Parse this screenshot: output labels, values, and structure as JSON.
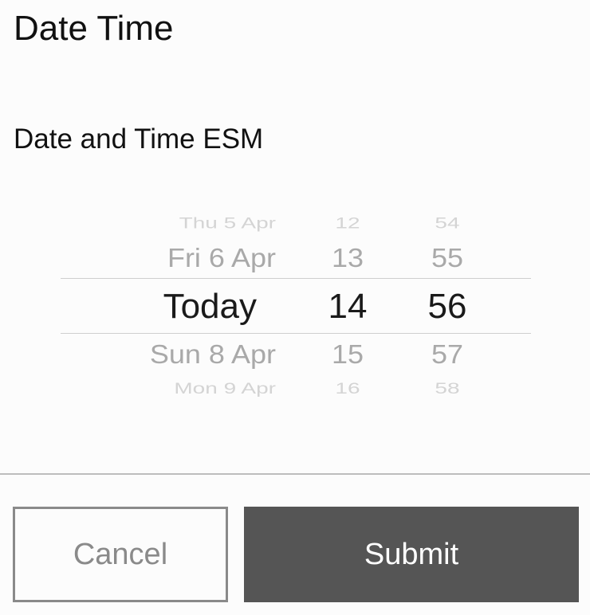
{
  "header": {
    "title": "Date Time"
  },
  "esm": {
    "question": "Date and Time ESM"
  },
  "picker": {
    "date_options": [
      "Thu 5 Apr",
      "Fri 6 Apr",
      "Today",
      "Sun 8 Apr",
      "Mon 9 Apr"
    ],
    "hour_options": [
      "12",
      "13",
      "14",
      "15",
      "16"
    ],
    "minute_options": [
      "54",
      "55",
      "56",
      "57",
      "58"
    ],
    "selected": {
      "date": "Today",
      "hour": "14",
      "minute": "56"
    }
  },
  "actions": {
    "cancel_label": "Cancel",
    "submit_label": "Submit"
  },
  "colors": {
    "background": "#fcfcfc",
    "submit_bg": "#555555",
    "cancel_border": "#8a8a8a",
    "selected_text": "#1a1a1a",
    "dim_text": "#a9a9a9"
  }
}
